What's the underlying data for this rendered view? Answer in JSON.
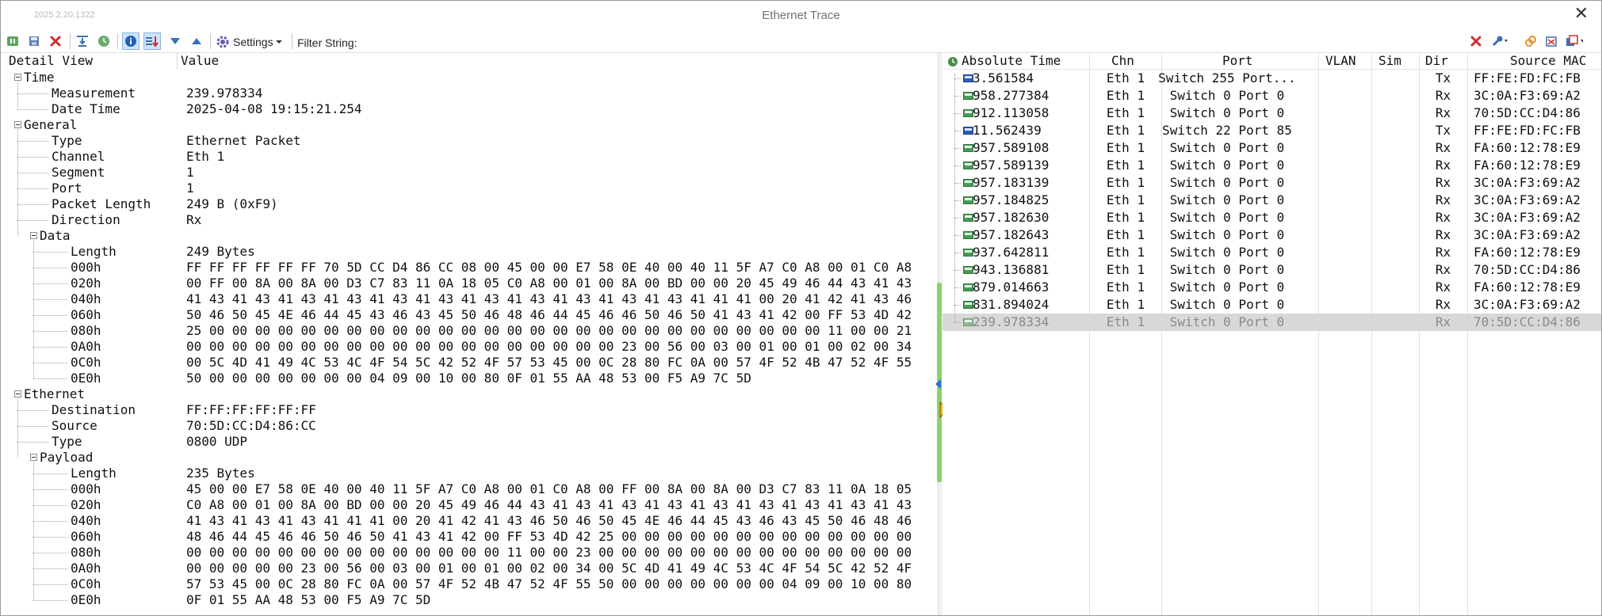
{
  "window": {
    "version": "2025.2.20.1322",
    "title": "Ethernet Trace",
    "close_glyph": "✕"
  },
  "toolbar": {
    "settings_label": "Settings",
    "filter_label": "Filter String:",
    "filter_value": "",
    "icons": [
      "pause-icon",
      "save-icon",
      "delete-icon",
      "scroll-to-end-icon",
      "clock-icon",
      "info-icon",
      "sort-icon",
      "arrow-down-icon",
      "arrow-up-icon",
      "gear-icon",
      "clear-filter-icon",
      "wrench-icon",
      "link-icon",
      "detach-icon",
      "window-menu-icon"
    ]
  },
  "detail": {
    "col_label": "Detail View",
    "col_value": "Value",
    "rows": [
      {
        "label": "Time",
        "value": "",
        "depth": 0,
        "toggle": true
      },
      {
        "label": "Measurement",
        "value": "239.978334",
        "depth": 1
      },
      {
        "label": "Date Time",
        "value": "2025-04-08 19:15:21.254",
        "depth": 1
      },
      {
        "label": "General",
        "value": "",
        "depth": 0,
        "toggle": true
      },
      {
        "label": "Type",
        "value": "Ethernet Packet",
        "depth": 1
      },
      {
        "label": "Channel",
        "value": "Eth 1",
        "depth": 1
      },
      {
        "label": "Segment",
        "value": "1",
        "depth": 1
      },
      {
        "label": "Port",
        "value": "1",
        "depth": 1
      },
      {
        "label": "Packet Length",
        "value": "249 B (0xF9)",
        "depth": 1
      },
      {
        "label": "Direction",
        "value": "Rx",
        "depth": 1
      },
      {
        "label": "Data",
        "value": "",
        "depth": 1,
        "toggle": true
      },
      {
        "label": "Length",
        "value": "249 Bytes",
        "depth": 2
      },
      {
        "label": "000h",
        "value": "FF FF FF FF FF FF 70 5D CC D4 86 CC 08 00 45 00 00 E7 58 0E 40 00 40 11 5F A7 C0 A8 00 01 C0 A8",
        "depth": 2
      },
      {
        "label": "020h",
        "value": "00 FF 00 8A 00 8A 00 D3 C7 83 11 0A 18 05 C0 A8 00 01 00 8A 00 BD 00 00 20 45 49 46 44 43 41 43",
        "depth": 2
      },
      {
        "label": "040h",
        "value": "41 43 41 43 41 43 41 43 41 43 41 43 41 43 41 43 41 43 41 43 41 43 41 41 41 00 20 41 42 41 43 46",
        "depth": 2
      },
      {
        "label": "060h",
        "value": "50 46 50 45 4E 46 44 45 43 46 43 45 50 46 48 46 44 45 46 46 50 46 50 41 43 41 42 00 FF 53 4D 42",
        "depth": 2
      },
      {
        "label": "080h",
        "value": "25 00 00 00 00 00 00 00 00 00 00 00 00 00 00 00 00 00 00 00 00 00 00 00 00 00 00 00 11 00 00 21",
        "depth": 2
      },
      {
        "label": "0A0h",
        "value": "00 00 00 00 00 00 00 00 00 00 00 00 00 00 00 00 00 00 00 23 00 56 00 03 00 01 00 01 00 02 00 34",
        "depth": 2
      },
      {
        "label": "0C0h",
        "value": "00 5C 4D 41 49 4C 53 4C 4F 54 5C 42 52 4F 57 53 45 00 0C 28 80 FC 0A 00 57 4F 52 4B 47 52 4F 55",
        "depth": 2
      },
      {
        "label": "0E0h",
        "value": "50 00 00 00 00 00 00 00 04 09 00 10 00 80 0F 01 55 AA 48 53 00 F5 A9 7C 5D",
        "depth": 2
      },
      {
        "label": "Ethernet",
        "value": "",
        "depth": 0,
        "toggle": true
      },
      {
        "label": "Destination",
        "value": "FF:FF:FF:FF:FF:FF",
        "depth": 1
      },
      {
        "label": "Source",
        "value": "70:5D:CC:D4:86:CC",
        "depth": 1
      },
      {
        "label": "Type",
        "value": "0800 UDP",
        "depth": 1
      },
      {
        "label": "Payload",
        "value": "",
        "depth": 1,
        "toggle": true
      },
      {
        "label": "Length",
        "value": "235 Bytes",
        "depth": 2
      },
      {
        "label": "000h",
        "value": "45 00 00 E7 58 0E 40 00 40 11 5F A7 C0 A8 00 01 C0 A8 00 FF 00 8A 00 8A 00 D3 C7 83 11 0A 18 05",
        "depth": 2
      },
      {
        "label": "020h",
        "value": "C0 A8 00 01 00 8A 00 BD 00 00 20 45 49 46 44 43 41 43 41 43 41 43 41 43 41 43 41 43 41 43 41 43",
        "depth": 2
      },
      {
        "label": "040h",
        "value": "41 43 41 43 41 43 41 41 41 00 20 41 42 41 43 46 50 46 50 45 4E 46 44 45 43 46 43 45 50 46 48 46",
        "depth": 2
      },
      {
        "label": "060h",
        "value": "48 46 44 45 46 46 50 46 50 41 43 41 42 00 FF 53 4D 42 25 00 00 00 00 00 00 00 00 00 00 00 00 00",
        "depth": 2
      },
      {
        "label": "080h",
        "value": "00 00 00 00 00 00 00 00 00 00 00 00 00 00 11 00 00 23 00 00 00 00 00 00 00 00 00 00 00 00 00 00",
        "depth": 2
      },
      {
        "label": "0A0h",
        "value": "00 00 00 00 00 23 00 56 00 03 00 01 00 01 00 02 00 34 00 5C 4D 41 49 4C 53 4C 4F 54 5C 42 52 4F",
        "depth": 2
      },
      {
        "label": "0C0h",
        "value": "57 53 45 00 0C 28 80 FC 0A 00 57 4F 52 4B 47 52 4F 55 50 00 00 00 00 00 00 00 04 09 00 10 00 80",
        "depth": 2
      },
      {
        "label": "0E0h",
        "value": "0F 01 55 AA 48 53 00 F5 A9 7C 5D",
        "depth": 2
      }
    ]
  },
  "trace": {
    "columns": [
      "Absolute Time",
      "Chn",
      "Port",
      "VLAN",
      "Sim",
      "Dir",
      "Source MAC"
    ],
    "rows": [
      {
        "time": "3.561584",
        "chn": "Eth 1",
        "port": "Switch 255 Port...",
        "vlan": "",
        "sim": "",
        "dir": "Tx",
        "mac": "FF:FE:FD:FC:FB"
      },
      {
        "time": "958.277384",
        "chn": "Eth 1",
        "port": "Switch 0 Port 0",
        "vlan": "",
        "sim": "",
        "dir": "Rx",
        "mac": "3C:0A:F3:69:A2"
      },
      {
        "time": "912.113058",
        "chn": "Eth 1",
        "port": "Switch 0 Port 0",
        "vlan": "",
        "sim": "",
        "dir": "Rx",
        "mac": "70:5D:CC:D4:86"
      },
      {
        "time": "11.562439",
        "chn": "Eth 1",
        "port": "Switch 22 Port 85",
        "vlan": "",
        "sim": "",
        "dir": "Tx",
        "mac": "FF:FE:FD:FC:FB"
      },
      {
        "time": "957.589108",
        "chn": "Eth 1",
        "port": "Switch 0 Port 0",
        "vlan": "",
        "sim": "",
        "dir": "Rx",
        "mac": "FA:60:12:78:E9"
      },
      {
        "time": "957.589139",
        "chn": "Eth 1",
        "port": "Switch 0 Port 0",
        "vlan": "",
        "sim": "",
        "dir": "Rx",
        "mac": "FA:60:12:78:E9"
      },
      {
        "time": "957.183139",
        "chn": "Eth 1",
        "port": "Switch 0 Port 0",
        "vlan": "",
        "sim": "",
        "dir": "Rx",
        "mac": "3C:0A:F3:69:A2"
      },
      {
        "time": "957.184825",
        "chn": "Eth 1",
        "port": "Switch 0 Port 0",
        "vlan": "",
        "sim": "",
        "dir": "Rx",
        "mac": "3C:0A:F3:69:A2"
      },
      {
        "time": "957.182630",
        "chn": "Eth 1",
        "port": "Switch 0 Port 0",
        "vlan": "",
        "sim": "",
        "dir": "Rx",
        "mac": "3C:0A:F3:69:A2"
      },
      {
        "time": "957.182643",
        "chn": "Eth 1",
        "port": "Switch 0 Port 0",
        "vlan": "",
        "sim": "",
        "dir": "Rx",
        "mac": "3C:0A:F3:69:A2"
      },
      {
        "time": "937.642811",
        "chn": "Eth 1",
        "port": "Switch 0 Port 0",
        "vlan": "",
        "sim": "",
        "dir": "Rx",
        "mac": "FA:60:12:78:E9"
      },
      {
        "time": "943.136881",
        "chn": "Eth 1",
        "port": "Switch 0 Port 0",
        "vlan": "",
        "sim": "",
        "dir": "Rx",
        "mac": "70:5D:CC:D4:86"
      },
      {
        "time": "879.014663",
        "chn": "Eth 1",
        "port": "Switch 0 Port 0",
        "vlan": "",
        "sim": "",
        "dir": "Rx",
        "mac": "FA:60:12:78:E9"
      },
      {
        "time": "831.894024",
        "chn": "Eth 1",
        "port": "Switch 0 Port 0",
        "vlan": "",
        "sim": "",
        "dir": "Rx",
        "mac": "3C:0A:F3:69:A2"
      },
      {
        "time": "239.978334",
        "chn": "Eth 1",
        "port": "Switch 0 Port 0",
        "vlan": "",
        "sim": "",
        "dir": "Rx",
        "mac": "70:5D:CC:D4:86",
        "selected": true
      }
    ]
  }
}
